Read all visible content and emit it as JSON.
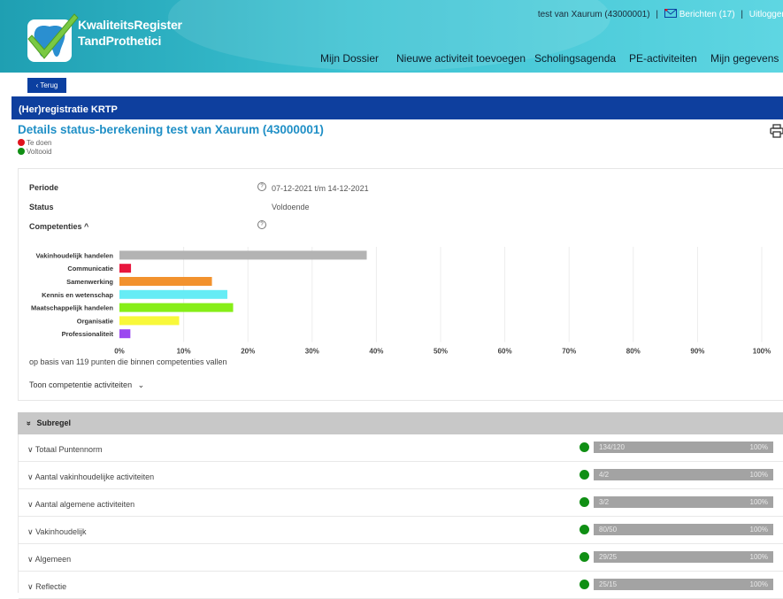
{
  "header": {
    "brand_line1": "KwaliteitsRegister",
    "brand_line2": "TandProthetici",
    "user": "test van Xaurum (43000001)",
    "messages": "Berichten (17)",
    "logout": "Uitloggen",
    "nav": [
      "Mijn Dossier",
      "Nieuwe activiteit toevoegen",
      "Scholingsagenda",
      "PE-activiteiten",
      "Mijn gegevens"
    ]
  },
  "back_label": "‹ Terug",
  "section_title": "(Her)registratie KRTP",
  "details_title": "Details status-berekening test van Xaurum (43000001)",
  "legend": [
    {
      "label": "Te doen",
      "color": "#e0141e"
    },
    {
      "label": "Voltooid",
      "color": "#108f14"
    }
  ],
  "info": {
    "periode_label": "Periode",
    "periode_value": "07-12-2021 t/m 14-12-2021",
    "status_label": "Status",
    "status_value": "Voldoende",
    "competenties_label": "Competenties ^",
    "help_glyph": "?"
  },
  "chart_data": {
    "type": "bar",
    "orientation": "horizontal",
    "categories": [
      "Vakinhoudelijk handelen",
      "Communicatie",
      "Samenwerking",
      "Kennis en wetenschap",
      "Maatschappelijk handelen",
      "Organisatie",
      "Professionaliteit"
    ],
    "values": [
      38.5,
      1.8,
      14.4,
      16.8,
      17.7,
      9.3,
      1.7
    ],
    "colors": [
      "#b3b3b3",
      "#e8173e",
      "#f2922e",
      "#66ecf5",
      "#86ee17",
      "#f8f83a",
      "#9b48f0"
    ],
    "xlim": [
      0,
      100
    ],
    "xticks": [
      "0%",
      "10%",
      "20%",
      "30%",
      "40%",
      "50%",
      "60%",
      "70%",
      "80%",
      "90%",
      "100%"
    ],
    "grid": true
  },
  "chart_note": "op basis van 119 punten die binnen competenties vallen",
  "toon_link": "Toon competentie activiteiten",
  "subregel_title": "Subregel",
  "subregels": [
    {
      "label": "Totaal Puntennorm",
      "value": "134/120",
      "percent": "100%"
    },
    {
      "label": "Aantal vakinhoudelijke activiteiten",
      "value": "4/2",
      "percent": "100%"
    },
    {
      "label": "Aantal algemene activiteiten",
      "value": "3/2",
      "percent": "100%"
    },
    {
      "label": "Vakinhoudelijk",
      "value": "80/50",
      "percent": "100%"
    },
    {
      "label": "Algemeen",
      "value": "29/25",
      "percent": "100%"
    },
    {
      "label": "Reflectie",
      "value": "25/15",
      "percent": "100%"
    }
  ]
}
